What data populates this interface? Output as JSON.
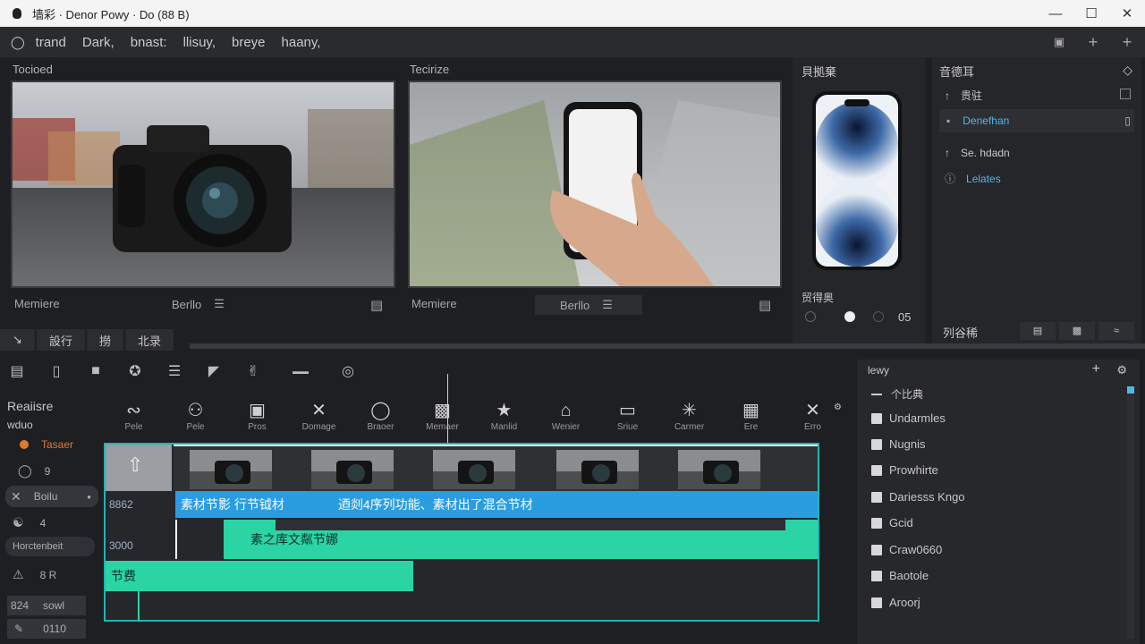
{
  "window": {
    "title": "墙彩 · Denor Powy · Do (88 B)",
    "controls": [
      "—",
      "☐",
      "✕"
    ]
  },
  "menu": {
    "items": [
      "trand",
      "Dark,",
      "bnast:",
      "llisuy,",
      "breye",
      "haany,"
    ]
  },
  "source_panel": {
    "label": "Tocioed",
    "name": "Memiere",
    "format": "Berllo"
  },
  "program_panel": {
    "label": "Tecirize",
    "name": "Memiere",
    "format": "Berllo"
  },
  "inspector": {
    "header": "貝拠棄",
    "section2": "贸得奥",
    "counter": "05",
    "footer": "列谷稀"
  },
  "effects_panel": {
    "header": "音德耳",
    "items": [
      {
        "label": "贵驻",
        "active": false
      },
      {
        "label": "Denefhan",
        "active": true
      },
      {
        "label": "Se. hdadn",
        "active": false
      },
      {
        "label": "Lelates",
        "active": true
      }
    ]
  },
  "tabs": [
    "設行",
    "撈",
    "北录"
  ],
  "fx_buttons": [
    "Pele",
    "Pros",
    "Domage",
    "Braoer",
    "Memaer",
    "Manlid",
    "Wenier",
    "Sriue",
    "Carmer",
    "Ere",
    "Erro"
  ],
  "tracks": {
    "header_title": "Reaiisre",
    "header_sub": "wduo",
    "rows": [
      {
        "label": "Tasaer",
        "accent": "#e07a2a"
      },
      {
        "label": "9",
        "accent": ""
      },
      {
        "label": "Boilu",
        "accent": ""
      },
      {
        "label": "4",
        "accent": ""
      },
      {
        "label": "Horctenbeit",
        "accent": ""
      },
      {
        "label": "8  R",
        "accent": ""
      },
      {
        "label": "824",
        "sub": "sowl"
      },
      {
        "label": "",
        "sub": "0110"
      }
    ],
    "timecodes": [
      "8862",
      "3000"
    ]
  },
  "clips": {
    "blue_text": "素材节影   行节钺材",
    "blue_text2": "迺剡4序列功能、素材出了混合节材",
    "green_text": "素之库文粼节娜",
    "green2_text": "节费"
  },
  "library": {
    "title": "lewy",
    "group": "个比典",
    "items": [
      "Undarmles",
      "Nugnis",
      "Prowhirte",
      "Dariesss Kngo",
      "Gcid",
      "Craw0660",
      "Baotole",
      "Aroorj"
    ]
  },
  "colors": {
    "accent_blue": "#2a9de0",
    "accent_green": "#2bd4a4",
    "timeline_border": "#1fb5b5"
  }
}
